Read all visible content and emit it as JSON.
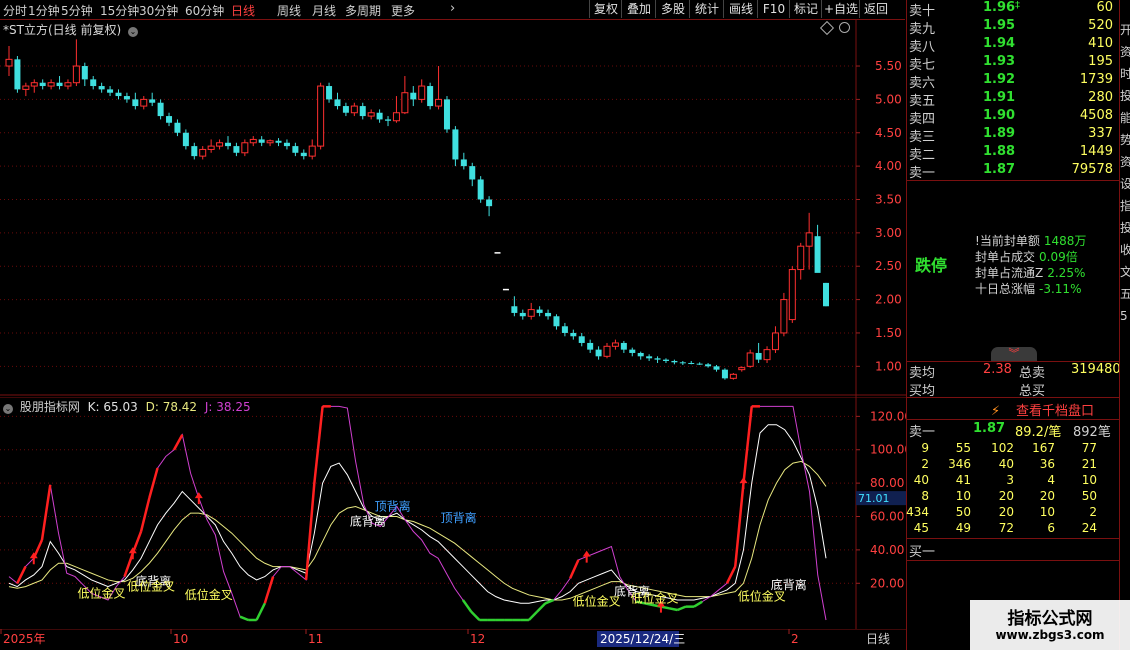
{
  "toolbar": {
    "timeframes": [
      "分时",
      "1分钟",
      "5分钟",
      "15分钟",
      "30分钟",
      "60分钟",
      "日线",
      "周线",
      "月线",
      "多周期",
      "更多"
    ],
    "active_timeframe": "日线",
    "more_arrow": "›",
    "right_buttons": [
      "复权",
      "叠加",
      "多股",
      "统计",
      "画线",
      "F10",
      "标记",
      "+自选",
      "返回"
    ]
  },
  "chart": {
    "title": "*ST立方(日线 前复权)",
    "price_axis": [
      "5.50",
      "5.00",
      "4.50",
      "4.00",
      "3.50",
      "3.00",
      "2.50",
      "2.00",
      "1.50",
      "1.00"
    ],
    "candles": [
      [
        5.5,
        5.8,
        5.35,
        5.6
      ],
      [
        5.6,
        5.65,
        5.1,
        5.15
      ],
      [
        5.15,
        5.25,
        5.05,
        5.2
      ],
      [
        5.2,
        5.3,
        5.1,
        5.25
      ],
      [
        5.25,
        5.3,
        5.15,
        5.2
      ],
      [
        5.2,
        5.3,
        5.15,
        5.25
      ],
      [
        5.25,
        5.35,
        5.15,
        5.2
      ],
      [
        5.2,
        5.3,
        5.15,
        5.25
      ],
      [
        5.25,
        5.9,
        5.2,
        5.5
      ],
      [
        5.5,
        5.55,
        5.2,
        5.3
      ],
      [
        5.3,
        5.35,
        5.15,
        5.2
      ],
      [
        5.2,
        5.25,
        5.1,
        5.15
      ],
      [
        5.15,
        5.2,
        5.05,
        5.1
      ],
      [
        5.1,
        5.15,
        5.0,
        5.05
      ],
      [
        5.05,
        5.1,
        4.95,
        5.0
      ],
      [
        5.0,
        5.1,
        4.85,
        4.9
      ],
      [
        4.9,
        5.05,
        4.85,
        5.0
      ],
      [
        5.0,
        5.1,
        4.9,
        4.95
      ],
      [
        4.95,
        5.0,
        4.7,
        4.75
      ],
      [
        4.75,
        4.8,
        4.6,
        4.65
      ],
      [
        4.65,
        4.7,
        4.45,
        4.5
      ],
      [
        4.5,
        4.55,
        4.25,
        4.3
      ],
      [
        4.3,
        4.35,
        4.1,
        4.15
      ],
      [
        4.15,
        4.3,
        4.1,
        4.25
      ],
      [
        4.25,
        4.4,
        4.2,
        4.3
      ],
      [
        4.3,
        4.4,
        4.25,
        4.35
      ],
      [
        4.35,
        4.45,
        4.25,
        4.3
      ],
      [
        4.3,
        4.35,
        4.15,
        4.2
      ],
      [
        4.2,
        4.4,
        4.15,
        4.35
      ],
      [
        4.35,
        4.45,
        4.3,
        4.4
      ],
      [
        4.4,
        4.45,
        4.3,
        4.35
      ],
      [
        4.35,
        4.4,
        4.3,
        4.38
      ],
      [
        4.38,
        4.42,
        4.3,
        4.35
      ],
      [
        4.35,
        4.4,
        4.25,
        4.3
      ],
      [
        4.3,
        4.35,
        4.15,
        4.2
      ],
      [
        4.2,
        4.25,
        4.1,
        4.15
      ],
      [
        4.15,
        4.4,
        4.1,
        4.3
      ],
      [
        4.3,
        5.25,
        4.25,
        5.2
      ],
      [
        5.2,
        5.25,
        4.95,
        5.0
      ],
      [
        5.0,
        5.1,
        4.85,
        4.9
      ],
      [
        4.9,
        4.95,
        4.75,
        4.8
      ],
      [
        4.8,
        4.95,
        4.75,
        4.9
      ],
      [
        4.9,
        4.95,
        4.7,
        4.75
      ],
      [
        4.75,
        4.85,
        4.7,
        4.8
      ],
      [
        4.8,
        4.85,
        4.65,
        4.7
      ],
      [
        4.7,
        4.75,
        4.6,
        4.68
      ],
      [
        4.68,
        5.05,
        4.65,
        4.8
      ],
      [
        4.8,
        5.35,
        4.78,
        5.1
      ],
      [
        5.1,
        5.2,
        4.9,
        5.0
      ],
      [
        5.0,
        5.3,
        4.95,
        5.2
      ],
      [
        5.2,
        5.25,
        4.85,
        4.9
      ],
      [
        4.9,
        5.5,
        4.85,
        5.0
      ],
      [
        5.0,
        5.05,
        4.5,
        4.55
      ],
      [
        4.55,
        4.6,
        4.0,
        4.1
      ],
      [
        4.1,
        4.2,
        3.95,
        4.0
      ],
      [
        4.0,
        4.05,
        3.7,
        3.8
      ],
      [
        3.8,
        3.85,
        3.45,
        3.5
      ],
      [
        3.5,
        3.55,
        3.25,
        3.4
      ],
      [
        2.7,
        2.7,
        2.7,
        2.7
      ],
      [
        2.15,
        2.15,
        2.15,
        2.15
      ],
      [
        1.9,
        2.05,
        1.75,
        1.8
      ],
      [
        1.8,
        1.85,
        1.7,
        1.75
      ],
      [
        1.75,
        1.95,
        1.7,
        1.85
      ],
      [
        1.85,
        1.9,
        1.75,
        1.8
      ],
      [
        1.8,
        1.85,
        1.7,
        1.75
      ],
      [
        1.75,
        1.78,
        1.55,
        1.6
      ],
      [
        1.6,
        1.65,
        1.45,
        1.5
      ],
      [
        1.5,
        1.55,
        1.4,
        1.45
      ],
      [
        1.45,
        1.5,
        1.3,
        1.35
      ],
      [
        1.35,
        1.4,
        1.2,
        1.25
      ],
      [
        1.25,
        1.3,
        1.1,
        1.15
      ],
      [
        1.15,
        1.35,
        1.12,
        1.3
      ],
      [
        1.3,
        1.4,
        1.25,
        1.35
      ],
      [
        1.35,
        1.38,
        1.2,
        1.25
      ],
      [
        1.25,
        1.28,
        1.15,
        1.2
      ],
      [
        1.2,
        1.22,
        1.1,
        1.15
      ],
      [
        1.15,
        1.18,
        1.08,
        1.12
      ],
      [
        1.12,
        1.15,
        1.05,
        1.1
      ],
      [
        1.1,
        1.12,
        1.05,
        1.08
      ],
      [
        1.08,
        1.1,
        1.03,
        1.06
      ],
      [
        1.06,
        1.08,
        1.02,
        1.05
      ],
      [
        1.05,
        1.08,
        1.03,
        1.04
      ],
      [
        1.04,
        1.06,
        1.02,
        1.03
      ],
      [
        1.03,
        1.05,
        0.98,
        1.0
      ],
      [
        1.0,
        1.02,
        0.92,
        0.95
      ],
      [
        0.95,
        0.97,
        0.8,
        0.82
      ],
      [
        0.82,
        0.9,
        0.8,
        0.88
      ],
      [
        0.95,
        1.0,
        0.92,
        0.98
      ],
      [
        1.0,
        1.25,
        0.98,
        1.2
      ],
      [
        1.2,
        1.35,
        1.05,
        1.1
      ],
      [
        1.1,
        1.3,
        1.05,
        1.25
      ],
      [
        1.25,
        1.6,
        1.2,
        1.5
      ],
      [
        1.5,
        2.1,
        1.45,
        2.0
      ],
      [
        1.7,
        2.5,
        1.65,
        2.45
      ],
      [
        2.45,
        2.85,
        2.3,
        2.8
      ],
      [
        2.8,
        3.3,
        2.45,
        3.0
      ],
      [
        2.95,
        3.12,
        2.45,
        2.4
      ],
      [
        2.25,
        2.25,
        1.9,
        1.9
      ]
    ],
    "x_labels": [
      "2025年",
      "10",
      "11",
      "12",
      "2",
      "日线"
    ],
    "date_highlight": "2025/12/24/三"
  },
  "indicator": {
    "name": "股朋指标网",
    "k_label": "K: 65.03",
    "d_label": "D: 78.42",
    "j_label": "J: 38.25",
    "axis": [
      "120.00",
      "100.00",
      "80.00",
      "60.00",
      "40.00",
      "20.00"
    ],
    "current_value": "71.01",
    "K": [
      20,
      18,
      22,
      25,
      30,
      45,
      38,
      30,
      28,
      25,
      22,
      20,
      18,
      20,
      22,
      28,
      35,
      45,
      55,
      62,
      68,
      75,
      70,
      65,
      60,
      55,
      45,
      38,
      30,
      25,
      22,
      24,
      28,
      30,
      30,
      28,
      26,
      50,
      80,
      90,
      92,
      85,
      75,
      65,
      60,
      58,
      60,
      62,
      58,
      55,
      52,
      48,
      45,
      40,
      35,
      30,
      25,
      20,
      15,
      12,
      10,
      9,
      8,
      8,
      9,
      10,
      10,
      12,
      15,
      20,
      22,
      24,
      26,
      28,
      22,
      18,
      15,
      14,
      13,
      12,
      11,
      10,
      10,
      10,
      11,
      12,
      14,
      16,
      20,
      40,
      80,
      110,
      115,
      115,
      112,
      105,
      95,
      85,
      65,
      35
    ],
    "D": [
      18,
      17,
      18,
      20,
      22,
      28,
      32,
      32,
      30,
      28,
      26,
      24,
      22,
      21,
      21,
      23,
      27,
      32,
      38,
      45,
      52,
      58,
      62,
      62,
      61,
      58,
      54,
      50,
      45,
      40,
      35,
      32,
      30,
      30,
      30,
      29,
      28,
      35,
      45,
      55,
      62,
      65,
      66,
      64,
      62,
      60,
      60,
      60,
      58,
      57,
      55,
      53,
      50,
      47,
      44,
      40,
      36,
      32,
      28,
      24,
      20,
      17,
      15,
      13,
      12,
      11,
      10,
      10,
      11,
      13,
      15,
      17,
      19,
      21,
      21,
      19,
      18,
      17,
      16,
      15,
      14,
      13,
      12,
      12,
      12,
      12,
      13,
      14,
      15,
      20,
      35,
      55,
      70,
      80,
      88,
      92,
      93,
      90,
      85,
      78
    ],
    "J": [
      24,
      20,
      30,
      35,
      46,
      79,
      50,
      26,
      24,
      19,
      14,
      12,
      10,
      18,
      24,
      38,
      51,
      71,
      89,
      96,
      100,
      109,
      86,
      71,
      58,
      49,
      27,
      14,
      0,
      -5,
      -4,
      8,
      24,
      30,
      30,
      26,
      22,
      80,
      150,
      160,
      152,
      125,
      93,
      67,
      56,
      54,
      60,
      66,
      58,
      51,
      46,
      38,
      35,
      26,
      17,
      10,
      3,
      -4,
      -11,
      -12,
      -10,
      -7,
      -6,
      -2,
      3,
      8,
      10,
      16,
      23,
      34,
      36,
      38,
      40,
      42,
      24,
      16,
      9,
      8,
      7,
      6,
      5,
      4,
      6,
      6,
      9,
      12,
      16,
      20,
      30,
      80,
      170,
      220,
      205,
      185,
      160,
      131,
      99,
      75,
      25,
      -51
    ],
    "annotations": [
      {
        "text": "低位金叉",
        "i": 10,
        "v": 14,
        "color": "#ffff60"
      },
      {
        "text": "底背离",
        "i": 17,
        "v": 21,
        "color": "#ffffff"
      },
      {
        "text": "低位金叉",
        "i": 16,
        "v": 18,
        "color": "#ffff60"
      },
      {
        "text": "低位金叉",
        "i": 23,
        "v": 13,
        "color": "#ffff60"
      },
      {
        "text": "底背离",
        "i": 43,
        "v": 57,
        "color": "#ffffff"
      },
      {
        "text": "顶背离",
        "i": 46,
        "v": 66,
        "color": "#40a0ff"
      },
      {
        "text": "顶背离",
        "i": 54,
        "v": 59,
        "color": "#40a0ff"
      },
      {
        "text": "低位金叉",
        "i": 70,
        "v": 9,
        "color": "#ffff60"
      },
      {
        "text": "底背离",
        "i": 75,
        "v": 15,
        "color": "#ffffff"
      },
      {
        "text": "低位金叉",
        "i": 77,
        "v": 11,
        "color": "#ffff60"
      },
      {
        "text": "低位金叉",
        "i": 90,
        "v": 12,
        "color": "#ffff60"
      },
      {
        "text": "底背离",
        "i": 94,
        "v": 19,
        "color": "#ffffff"
      }
    ],
    "buy_arrows": [
      3,
      15,
      23,
      38,
      70,
      79,
      89
    ]
  },
  "quote": {
    "asks": [
      {
        "label": "卖十",
        "price": "1.96",
        "mark": "‡",
        "vol": "60"
      },
      {
        "label": "卖九",
        "price": "1.95",
        "mark": "",
        "vol": "520"
      },
      {
        "label": "卖八",
        "price": "1.94",
        "mark": "",
        "vol": "410"
      },
      {
        "label": "卖七",
        "price": "1.93",
        "mark": "",
        "vol": "195"
      },
      {
        "label": "卖六",
        "price": "1.92",
        "mark": "",
        "vol": "1739"
      },
      {
        "label": "卖五",
        "price": "1.91",
        "mark": "",
        "vol": "280"
      },
      {
        "label": "卖四",
        "price": "1.90",
        "mark": "",
        "vol": "4508"
      },
      {
        "label": "卖三",
        "price": "1.89",
        "mark": "",
        "vol": "337"
      },
      {
        "label": "卖二",
        "price": "1.88",
        "mark": "",
        "vol": "1449"
      },
      {
        "label": "卖一",
        "price": "1.87",
        "mark": "",
        "vol": "79578"
      }
    ],
    "status": "跌停",
    "stats": [
      {
        "label": "当前封单额",
        "value": "1488万",
        "prefix": "!"
      },
      {
        "label": "封单占成交",
        "value": "0.09倍",
        "prefix": ""
      },
      {
        "label": "封单占流通Z",
        "value": "2.25%",
        "prefix": ""
      },
      {
        "label": "十日总涨幅",
        "value": "-3.11%",
        "prefix": ""
      }
    ],
    "expand_icon": "︾",
    "avg_ask_label": "卖均",
    "avg_ask_value": "2.38",
    "total_ask_label": "总卖",
    "total_ask_value": "319480",
    "avg_bid_label": "买均",
    "total_bid_label": "总买",
    "depth_button": "查看千档盘口",
    "lightning_icon": "⚡",
    "sell1_label": "卖一",
    "sell1_price": "1.87",
    "sell1_per": "89.2/笔",
    "sell1_count": "892笔",
    "order_book": [
      [
        "9",
        "55",
        "102",
        "167",
        "77"
      ],
      [
        "2",
        "346",
        "40",
        "36",
        "21"
      ],
      [
        "40",
        "41",
        "3",
        "4",
        "10"
      ],
      [
        "8",
        "10",
        "20",
        "20",
        "50"
      ],
      [
        "434",
        "50",
        "20",
        "10",
        "2"
      ],
      [
        "45",
        "49",
        "72",
        "6",
        "24"
      ]
    ],
    "buy1_label": "买一"
  },
  "right_cut_text": [
    "开",
    "资",
    "时",
    "投",
    "能",
    "势",
    "资",
    "设",
    "指",
    "投",
    "收",
    "文",
    "五",
    "5"
  ],
  "watermark": {
    "title": "指标公式网",
    "url": "www.zbgs3.com"
  },
  "colors": {
    "up": "#ff3030",
    "down": "#40e0e0",
    "grid": "#7a1010",
    "price_green": "#30e030",
    "J": "#d040d0",
    "D": "#e8e880",
    "K": "#ffffff"
  }
}
